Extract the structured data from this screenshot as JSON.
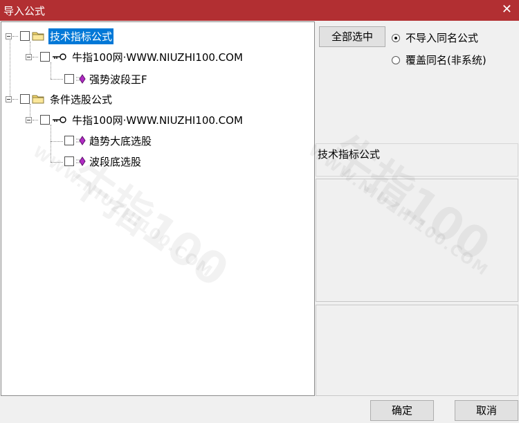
{
  "window": {
    "title": "导入公式",
    "close_glyph": "✕"
  },
  "tree": {
    "nodes": [
      {
        "label": "技术指标公式",
        "icon": "folder-icon",
        "expanded": true,
        "selected": true
      },
      {
        "label": "牛指100网·WWW.NIUZHI100.COM",
        "icon": "key-icon",
        "expanded": true
      },
      {
        "label": "强势波段王F",
        "icon": "formula-icon"
      },
      {
        "label": "条件选股公式",
        "icon": "folder-icon",
        "expanded": true
      },
      {
        "label": "牛指100网·WWW.NIUZHI100.COM",
        "icon": "key-icon",
        "expanded": true
      },
      {
        "label": "趋势大底选股",
        "icon": "formula-icon"
      },
      {
        "label": "波段底选股",
        "icon": "formula-icon"
      }
    ]
  },
  "actions": {
    "select_all_label": "全部选中",
    "radio_no_import_label": "不导入同名公式",
    "radio_overwrite_label": "覆盖同名(非系统)",
    "radio_selected": "no_import",
    "ok_label": "确定",
    "cancel_label": "取消"
  },
  "info": {
    "category_text": "技术指标公式"
  },
  "watermark": {
    "text": "牛指100",
    "url": "WWW.NIUZHI100.COM"
  },
  "colors": {
    "titlebar": "#b22f32",
    "selection": "#0078d7",
    "folder": "#f6d86b",
    "formula": "#b12bc4"
  }
}
